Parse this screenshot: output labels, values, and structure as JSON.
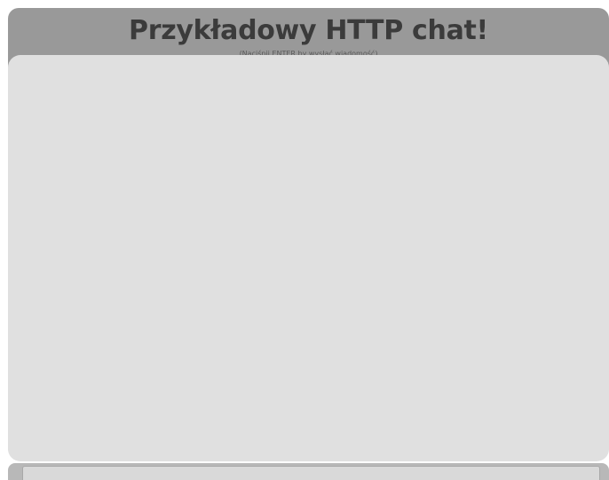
{
  "header": {
    "title": "Przykładowy HTTP chat!",
    "subtitle": "(Naciśnij ENTER by wysłać wiadomość)"
  },
  "messages": [],
  "input": {
    "value": "",
    "placeholder": ""
  },
  "colors": {
    "header_background": "#999999",
    "messages_background": "#e0e0e0",
    "input_bar_background": "#b8b8b8",
    "title_text": "#3b3b3b"
  }
}
